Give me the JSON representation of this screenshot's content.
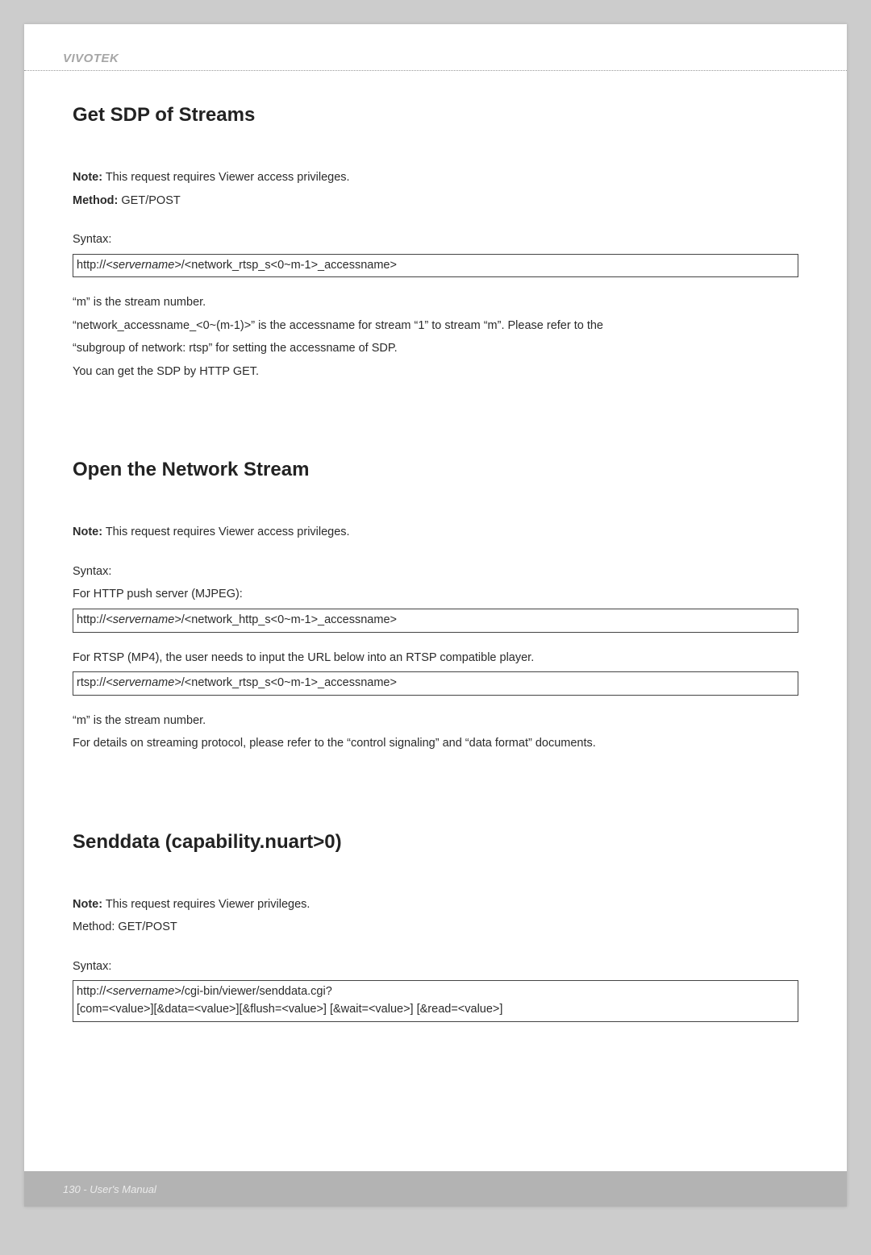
{
  "brand": "VIVOTEK",
  "footer": "130 - User's Manual",
  "sections": {
    "s1": {
      "heading": "Get SDP of Streams",
      "noteLabel": "Note:",
      "noteText": " This request requires Viewer access privileges.",
      "methodLabel": "Method:",
      "methodText": " GET/POST",
      "syntaxLabel": "Syntax:",
      "syntaxPrefix": "http://",
      "syntaxItalic": "<servername>",
      "syntaxSuffix": "/<network_rtsp_s<0~m-1>_accessname>",
      "p1": "“m” is the stream number.",
      "p2": "“network_accessname_<0~(m-1)>” is the accessname for stream “1” to stream “m”. Please refer to the",
      "p3": "“subgroup of network: rtsp” for setting the accessname of SDP.",
      "p4": "You can get the SDP by HTTP GET."
    },
    "s2": {
      "heading": "Open the Network Stream",
      "noteLabel": "Note:",
      "noteText": " This request requires Viewer access privileges.",
      "syntaxLabel": "Syntax:",
      "pushLabel": "For HTTP push server (MJPEG):",
      "pushPrefix": "http://",
      "pushItalic": "<servername>",
      "pushSuffix": "/<network_http_s<0~m-1>_accessname>",
      "rtspLabel": "For RTSP (MP4), the user needs to input the URL below into an RTSP compatible player.",
      "rtspPrefix": "rtsp://",
      "rtspItalic": "<servername>",
      "rtspSuffix": "/<network_rtsp_s<0~m-1>_accessname>",
      "p1": "“m” is the stream number.",
      "p2": "For details on streaming protocol, please refer to the “control signaling” and “data format” documents."
    },
    "s3": {
      "heading": "Senddata (capability.nuart>0)",
      "noteLabel": "Note:",
      "noteText": " This request requires Viewer privileges.",
      "methodLine": "Method: GET/POST",
      "syntaxLabel": "Syntax:",
      "line1Prefix": "http://",
      "line1Italic": "<servername>",
      "line1Suffix": "/cgi-bin/viewer/senddata.cgi?",
      "line2": "[com=<value>][&data=<value>][&flush=<value>] [&wait=<value>] [&read=<value>]"
    }
  }
}
